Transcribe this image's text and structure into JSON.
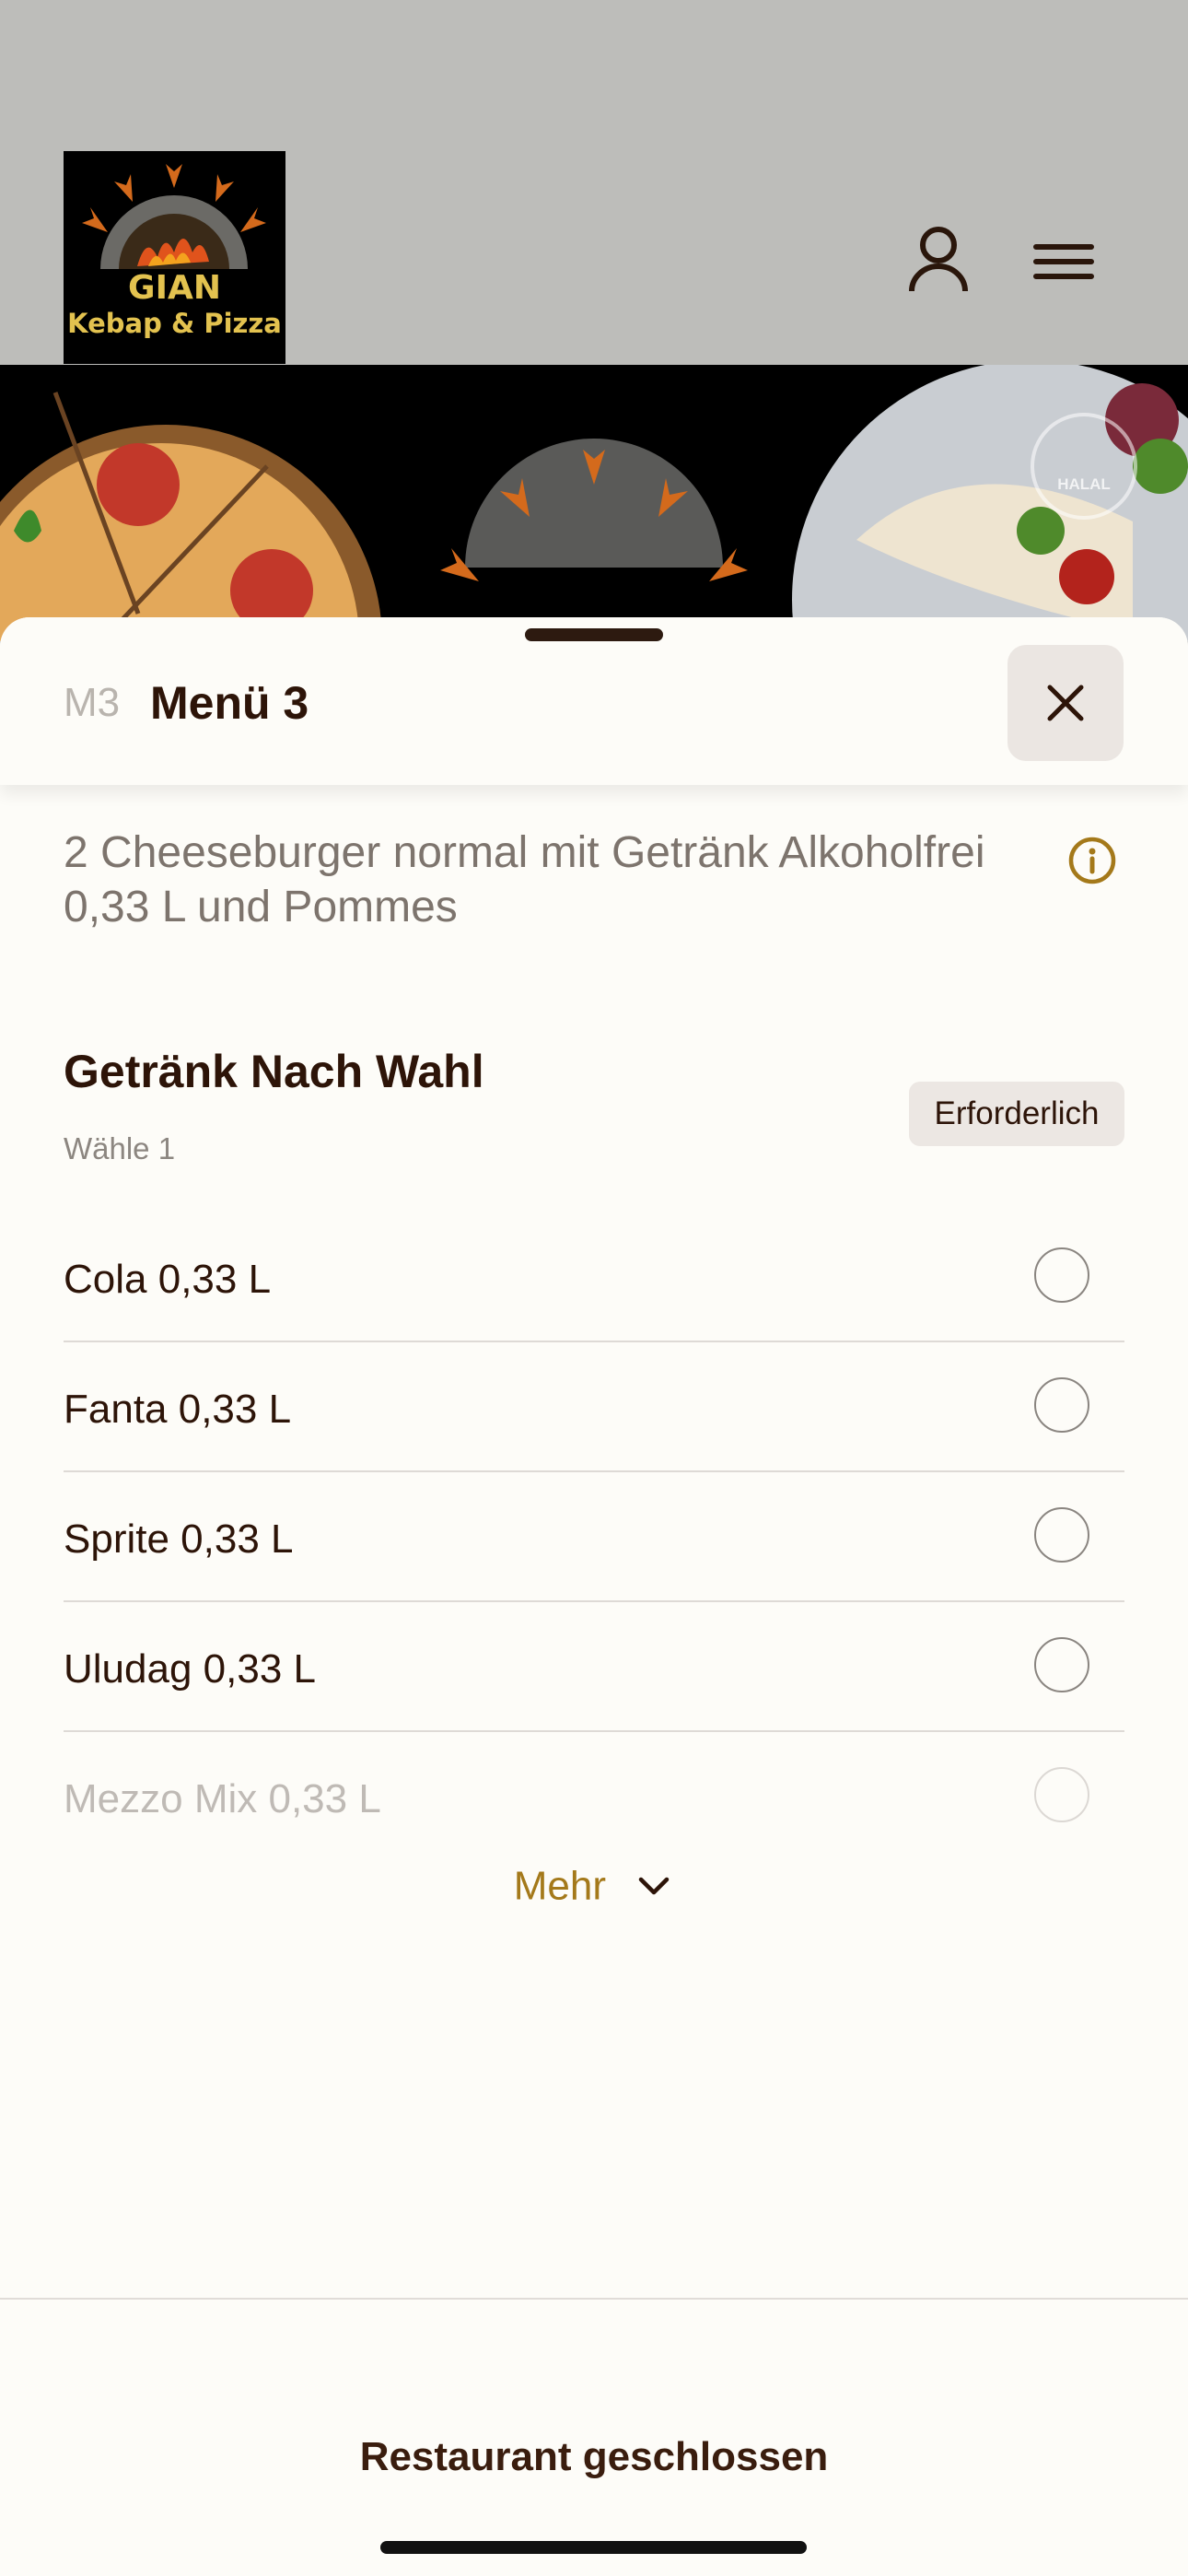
{
  "header": {
    "logo": {
      "line1": "GIAN",
      "line2": "Kebap & Pizza"
    },
    "account_icon": "person-icon",
    "menu_icon": "hamburger-icon"
  },
  "hero": {
    "badge_text": "HALAL"
  },
  "sheet": {
    "code": "M3",
    "title": "Menü 3",
    "close_icon": "close-icon",
    "description": "2 Cheeseburger normal mit Getränk Alkoholfrei 0,33 L und Pommes",
    "info_icon": "info-icon"
  },
  "group": {
    "title": "Getränk Nach Wahl",
    "subtitle": "Wähle 1",
    "badge": "Erforderlich",
    "options": [
      {
        "label": "Cola 0,33 L",
        "selected": false
      },
      {
        "label": "Fanta 0,33 L",
        "selected": false
      },
      {
        "label": "Sprite 0,33 L",
        "selected": false
      },
      {
        "label": "Uludag 0,33 L",
        "selected": false
      },
      {
        "label": "Mezzo Mix 0,33 L",
        "selected": false
      }
    ],
    "more_label": "Mehr"
  },
  "footer": {
    "status": "Restaurant geschlossen"
  },
  "colors": {
    "accent": "#a4791a",
    "text_dark": "#2d1408",
    "sheet_bg": "#fdfcf8"
  }
}
